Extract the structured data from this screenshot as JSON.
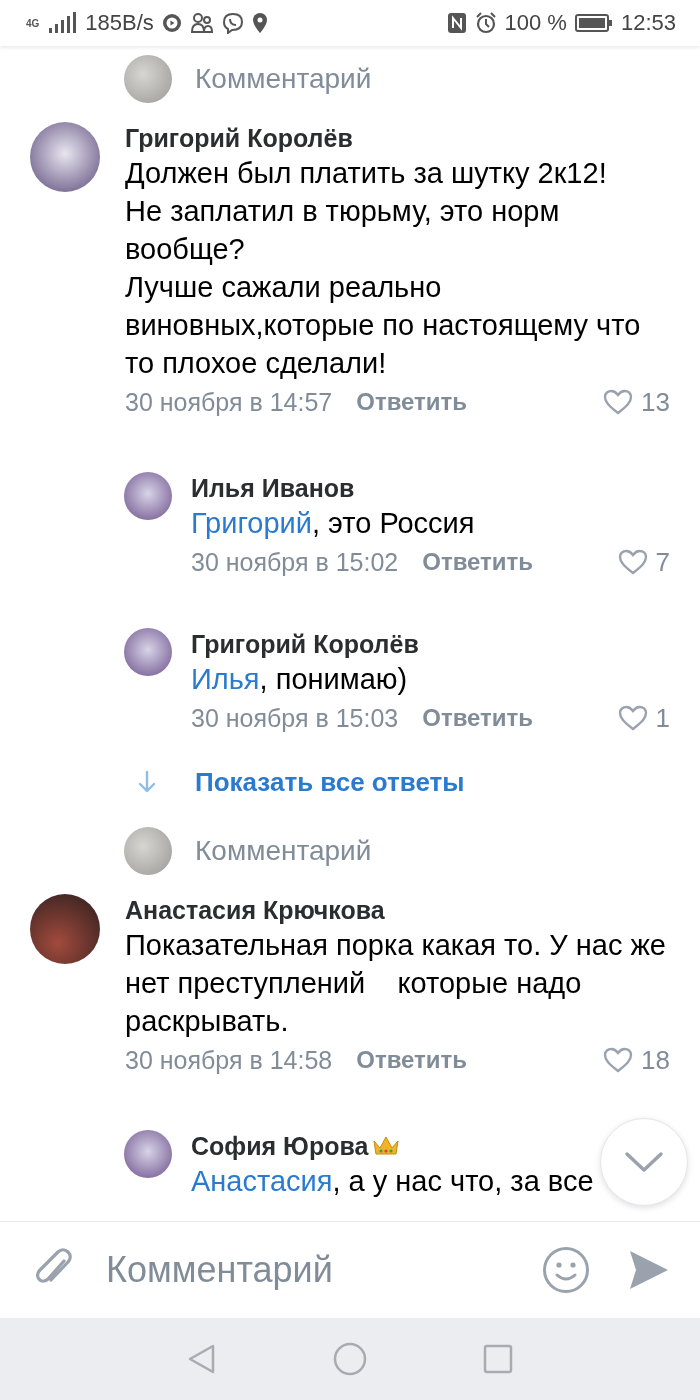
{
  "status_bar": {
    "network": "4G",
    "speed": "185B/s",
    "battery": "100 %",
    "time": "12:53"
  },
  "feed": [
    {
      "kind": "prompt",
      "placeholder": "Комментарий"
    },
    {
      "kind": "comment",
      "author": "Григорий Королёв",
      "text": "Должен был платить за шутку 2к12!\nНе заплатил в тюрьму, это норм вообще?\nЛучше сажали реально виновных,которые по настоящему что то плохое сделали!",
      "date": "30 ноября в 14:57",
      "reply_label": "Ответить",
      "likes": "13",
      "replies": [
        {
          "author": "Илья Иванов",
          "mention": "Григорий",
          "text": ", это Россия",
          "date": "30 ноября в 15:02",
          "reply_label": "Ответить",
          "likes": "7"
        },
        {
          "author": "Григорий Королёв",
          "mention": "Илья",
          "text": ", понимаю)",
          "date": "30 ноября в 15:03",
          "reply_label": "Ответить",
          "likes": "1"
        }
      ]
    },
    {
      "kind": "show_all",
      "label": "Показать все ответы"
    },
    {
      "kind": "prompt",
      "placeholder": "Комментарий"
    },
    {
      "kind": "comment",
      "author": "Анастасия Крючкова",
      "text": "Показательная порка какая то. У нас же нет преступлений    которые надо раскрывать.",
      "date": "30 ноября в 14:58",
      "reply_label": "Ответить",
      "likes": "18",
      "replies": [
        {
          "author": "София Юрова",
          "crown": true,
          "mention": "Анастасия",
          "text": ", а у нас что, за все"
        }
      ]
    }
  ],
  "composer": {
    "placeholder": "Комментарий"
  }
}
